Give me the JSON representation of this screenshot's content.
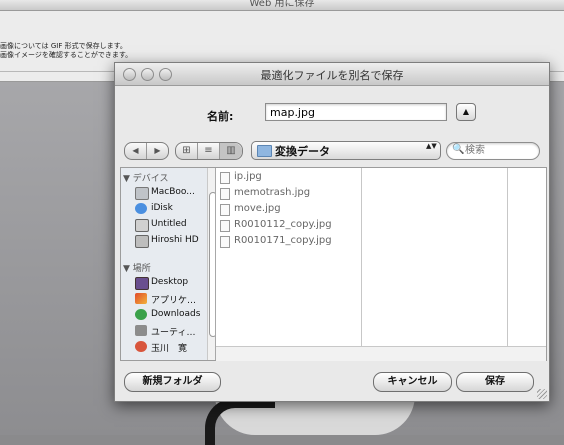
{
  "background_app": {
    "title": "Web 用に保存",
    "info_line1": "画像については GIF 形式で保存します。",
    "info_line2": "画像イメージを確認することができます。"
  },
  "dialog": {
    "title": "最適化ファイルを別名で保存",
    "name_label": "名前:",
    "name_value": "map.jpg",
    "expand_glyph": "▲",
    "nav_back": "◀",
    "nav_forward": "▶",
    "view_icons": "⊞",
    "view_list": "≡",
    "view_columns": "▥",
    "location": "変換データ",
    "location_arrows": "▲▼",
    "search_icon": "🔍",
    "search_placeholder": "検索",
    "sidebar": {
      "devices_header": "▼ デバイス",
      "devices": [
        {
          "label": "MacBoo...",
          "icon": "laptop-icon"
        },
        {
          "label": "iDisk",
          "icon": "idisk-icon"
        },
        {
          "label": "Untitled",
          "icon": "disk-icon"
        },
        {
          "label": "Hiroshi HD",
          "icon": "disk-icon"
        }
      ],
      "places_header": "▼ 場所",
      "places": [
        {
          "label": "Desktop",
          "icon": "desktop-icon"
        },
        {
          "label": "アプリケ…",
          "icon": "applications-icon"
        },
        {
          "label": "Downloads",
          "icon": "downloads-icon"
        },
        {
          "label": "ユーティ…",
          "icon": "utilities-icon"
        },
        {
          "label": "玉川　寛",
          "icon": "home-icon"
        }
      ]
    },
    "files": [
      "ip.jpg",
      "memotrash.jpg",
      "move.jpg",
      "R0010112_copy.jpg",
      "R0010171_copy.jpg"
    ],
    "new_folder_label": "新規フォルダ",
    "cancel_label": "キャンセル",
    "save_label": "保存"
  }
}
